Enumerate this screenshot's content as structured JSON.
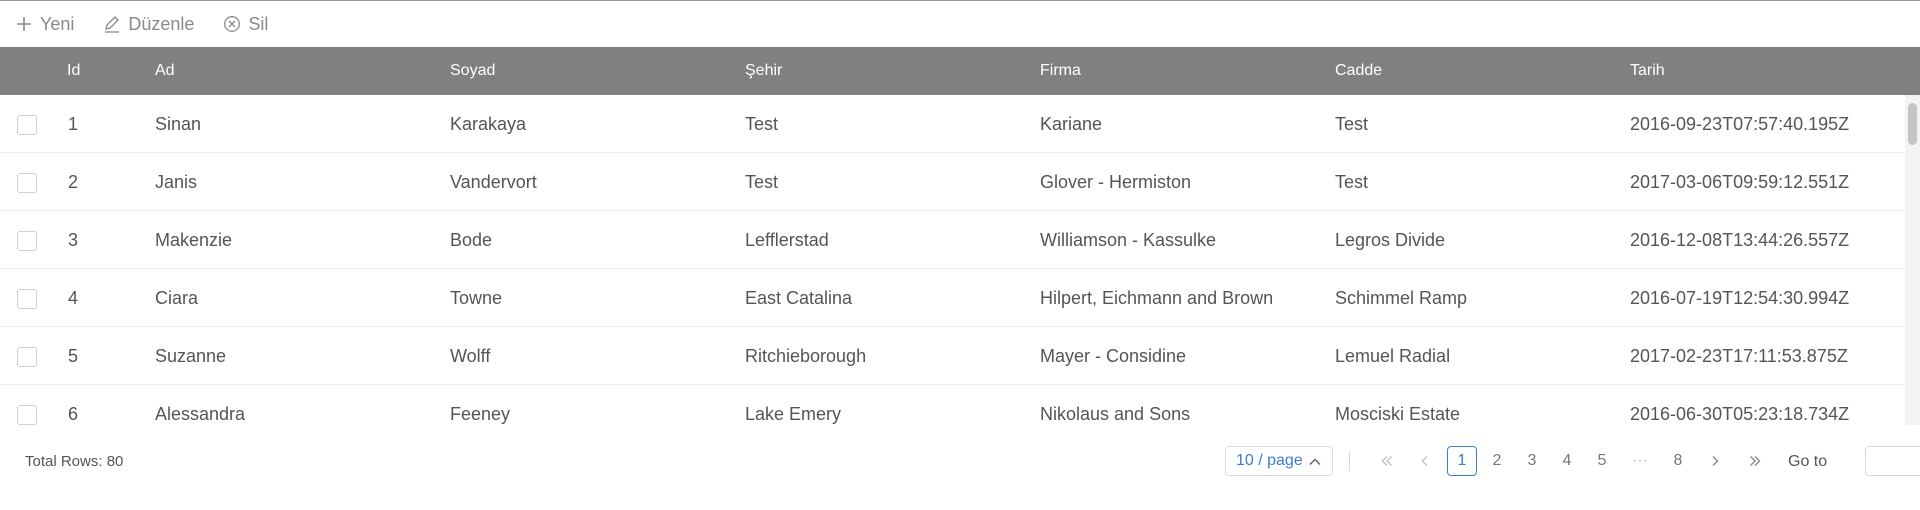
{
  "toolbar": {
    "new": {
      "label": "Yeni",
      "icon": "plus-icon"
    },
    "edit": {
      "label": "Düzenle",
      "icon": "pencil-icon"
    },
    "delete": {
      "label": "Sil",
      "icon": "close-circle-icon"
    }
  },
  "table": {
    "headers": {
      "id": "Id",
      "ad": "Ad",
      "soyad": "Soyad",
      "sehir": "Şehir",
      "firma": "Firma",
      "cadde": "Cadde",
      "tarih": "Tarih"
    },
    "rows": [
      {
        "id": "1",
        "ad": "Sinan",
        "soyad": "Karakaya",
        "sehir": "Test",
        "firma": "Kariane",
        "cadde": "Test",
        "tarih": "2016-09-23T07:57:40.195Z"
      },
      {
        "id": "2",
        "ad": "Janis",
        "soyad": "Vandervort",
        "sehir": "Test",
        "firma": "Glover - Hermiston",
        "cadde": "Test",
        "tarih": "2017-03-06T09:59:12.551Z"
      },
      {
        "id": "3",
        "ad": "Makenzie",
        "soyad": "Bode",
        "sehir": "Lefflerstad",
        "firma": "Williamson - Kassulke",
        "cadde": "Legros Divide",
        "tarih": "2016-12-08T13:44:26.557Z"
      },
      {
        "id": "4",
        "ad": "Ciara",
        "soyad": "Towne",
        "sehir": "East Catalina",
        "firma": "Hilpert, Eichmann and Brown",
        "cadde": "Schimmel Ramp",
        "tarih": "2016-07-19T12:54:30.994Z"
      },
      {
        "id": "5",
        "ad": "Suzanne",
        "soyad": "Wolff",
        "sehir": "Ritchieborough",
        "firma": "Mayer - Considine",
        "cadde": "Lemuel Radial",
        "tarih": "2017-02-23T17:11:53.875Z"
      },
      {
        "id": "6",
        "ad": "Alessandra",
        "soyad": "Feeney",
        "sehir": "Lake Emery",
        "firma": "Nikolaus and Sons",
        "cadde": "Mosciski Estate",
        "tarih": "2016-06-30T05:23:18.734Z"
      }
    ]
  },
  "footer": {
    "total_rows": "Total Rows: 80",
    "page_size": "10 / page",
    "pages": [
      "1",
      "2",
      "3",
      "4",
      "5"
    ],
    "ellipsis": "···",
    "last_page": "8",
    "current_page": "1",
    "goto_label": "Go to"
  },
  "colors": {
    "header_bg": "#808080",
    "accent": "#3b7bd0"
  }
}
